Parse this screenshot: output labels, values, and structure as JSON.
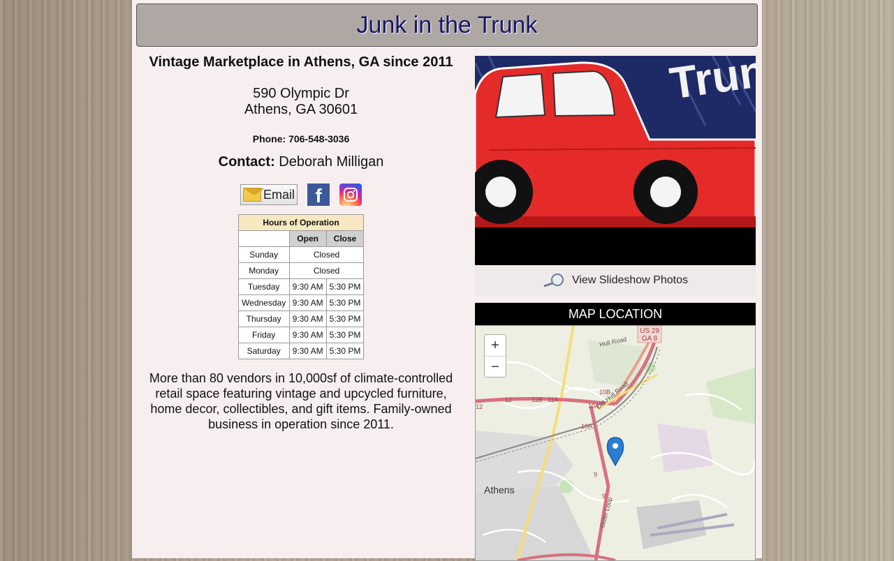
{
  "header": {
    "title": "Junk in the Trunk"
  },
  "info": {
    "tagline": "Vintage Marketplace in Athens, GA since 2011",
    "address_line1": "590 Olympic Dr",
    "address_line2": "Athens, GA 30601",
    "phone": "Phone: 706-548-3036",
    "contact_label": "Contact:",
    "contact_name": "Deborah Milligan"
  },
  "social": {
    "email_label": "Email",
    "facebook_glyph": "f"
  },
  "hours": {
    "title": "Hours of Operation",
    "col_open": "Open",
    "col_close": "Close",
    "rows": [
      {
        "day": "Sunday",
        "closed": "Closed"
      },
      {
        "day": "Monday",
        "closed": "Closed"
      },
      {
        "day": "Tuesday",
        "open": "9:30 AM",
        "close": "5:30 PM"
      },
      {
        "day": "Wednesday",
        "open": "9:30 AM",
        "close": "5:30 PM"
      },
      {
        "day": "Thursday",
        "open": "9:30 AM",
        "close": "5:30 PM"
      },
      {
        "day": "Friday",
        "open": "9:30 AM",
        "close": "5:30 PM"
      },
      {
        "day": "Saturday",
        "open": "9:30 AM",
        "close": "5:30 PM"
      }
    ]
  },
  "description": "More than 80 vendors in 10,000sf of climate-controlled retail space featuring vintage and upcycled furniture, home decor, collectibles, and gift items. Family-owned business in operation since 2011.",
  "slideshow": {
    "label": "View Slideshow Photos",
    "photo_text": "Trunk"
  },
  "map": {
    "heading": "MAP LOCATION",
    "zoom_in": "+",
    "zoom_out": "−",
    "labels": {
      "city": "Athens",
      "us29": "US 29",
      "ga8": "GA 8",
      "hull_road": "Hull Road",
      "old_hull_road": "Old Hull Road",
      "outer_loop": "Outer Loop",
      "exit_12a": "12",
      "exit_12b": "12",
      "exit_11b": "11B",
      "exit_11a": "11A",
      "exit_10b": "10B",
      "exit_10a1": "10A",
      "exit_10a2": "10A",
      "exit_9a": "9",
      "exit_9b": "9"
    }
  },
  "colors": {
    "title": "#161665",
    "header_bg": "#aea7a3",
    "page_bg": "#f7efef",
    "marker": "#2a7fd4"
  }
}
